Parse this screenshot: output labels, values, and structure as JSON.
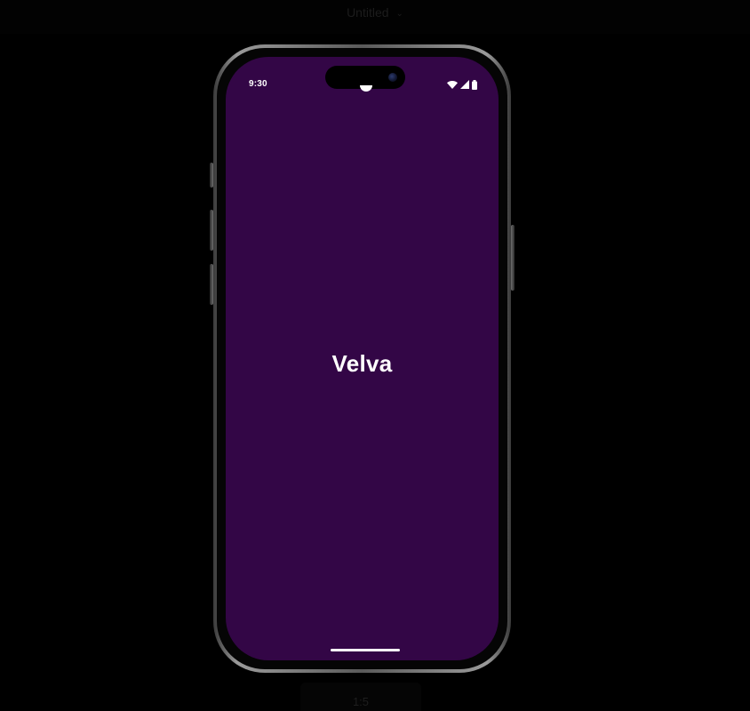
{
  "editor": {
    "document_title": "Untitled",
    "zoom_label": "1:5"
  },
  "device": {
    "screen_background": "#330646",
    "status_bar": {
      "time": "9:30",
      "icons": [
        "wifi-icon",
        "cellular-signal-icon",
        "battery-icon"
      ]
    }
  },
  "app": {
    "title": "Velva"
  }
}
